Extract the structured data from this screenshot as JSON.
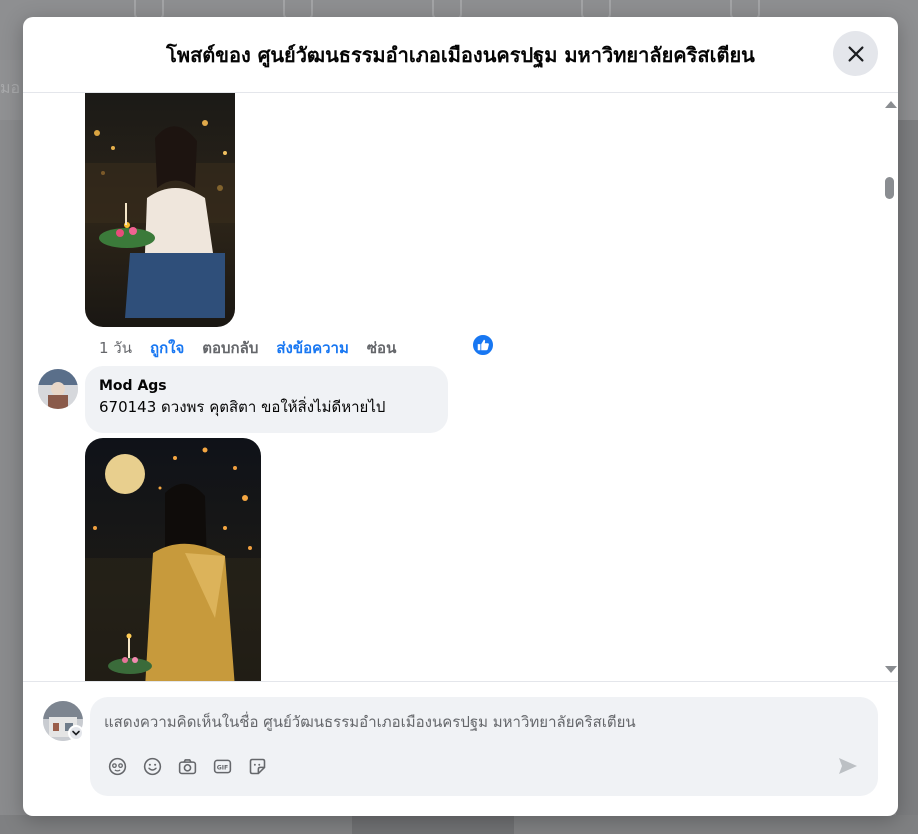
{
  "background": {
    "left_partial_text": "มอ"
  },
  "modal": {
    "title": "โพสต์ของ ศูนย์วัฒนธรรมอำเภอเมืองนครปฐม มหาวิทยาลัยคริสเตียน",
    "close_icon": "close-icon"
  },
  "comment_actions": {
    "time": "1 วัน",
    "like": "ถูกใจ",
    "reply": "ตอบกลับ",
    "send_message": "ส่งข้อความ",
    "hide": "ซ่อน"
  },
  "comment": {
    "author": "Mod Ags",
    "text": "670143 ดวงพร คุตสิตา ขอให้สิ่งไม่ดีหายไป"
  },
  "composer": {
    "placeholder": "แสดงความคิดเห็นในชื่อ ศูนย์วัฒนธรรมอำเภอเมืองนครปฐม มหาวิทยาลัยคริสเตียน",
    "tools": [
      "avatar-sticker-icon",
      "emoji-icon",
      "camera-icon",
      "gif-icon",
      "sticker-icon"
    ],
    "send_icon": "send-icon"
  },
  "colors": {
    "accent": "#1877f2",
    "secondary_text": "#65676b",
    "bubble": "#f0f2f5"
  }
}
